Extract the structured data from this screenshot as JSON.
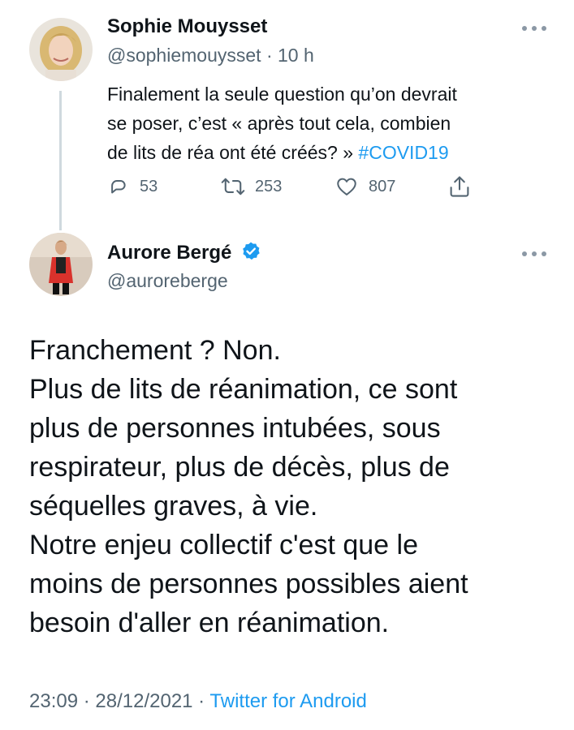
{
  "reply_tweet": {
    "author_name": "Sophie Mouysset",
    "handle": "@sophiemouysset",
    "separator": "·",
    "time_ago": "10 h",
    "text_lines": [
      "Finalement la seule question qu’on devrait",
      "se poser, c’est « après tout cela, combien",
      "de lits de réa ont été créés? » "
    ],
    "hashtag": "#COVID19",
    "stats": {
      "replies": "53",
      "retweets": "253",
      "likes": "807"
    },
    "icons": [
      "reply-icon",
      "retweet-icon",
      "like-icon",
      "share-icon",
      "more-icon"
    ]
  },
  "main_tweet": {
    "author_name": "Aurore Bergé",
    "verified": true,
    "handle": "@auroreberge",
    "text_lines": [
      "Franchement ? Non.",
      "Plus de lits de réanimation, ce sont",
      "plus de personnes intubées, sous",
      "respirateur, plus de décès, plus de",
      "séquelles graves, à vie.",
      "Notre enjeu collectif c'est que le",
      "moins de personnes possibles aient",
      "besoin d'aller en réanimation."
    ],
    "time": "23:09",
    "separator_1": " · ",
    "date": "28/12/2021",
    "separator_2": " · ",
    "source": "Twitter for Android",
    "icons": [
      "verified-badge-icon",
      "more-icon"
    ]
  },
  "colors": {
    "text": "#0f1419",
    "secondary": "#536471",
    "link": "#1d9bf0",
    "thread_line": "#cfd9de"
  }
}
